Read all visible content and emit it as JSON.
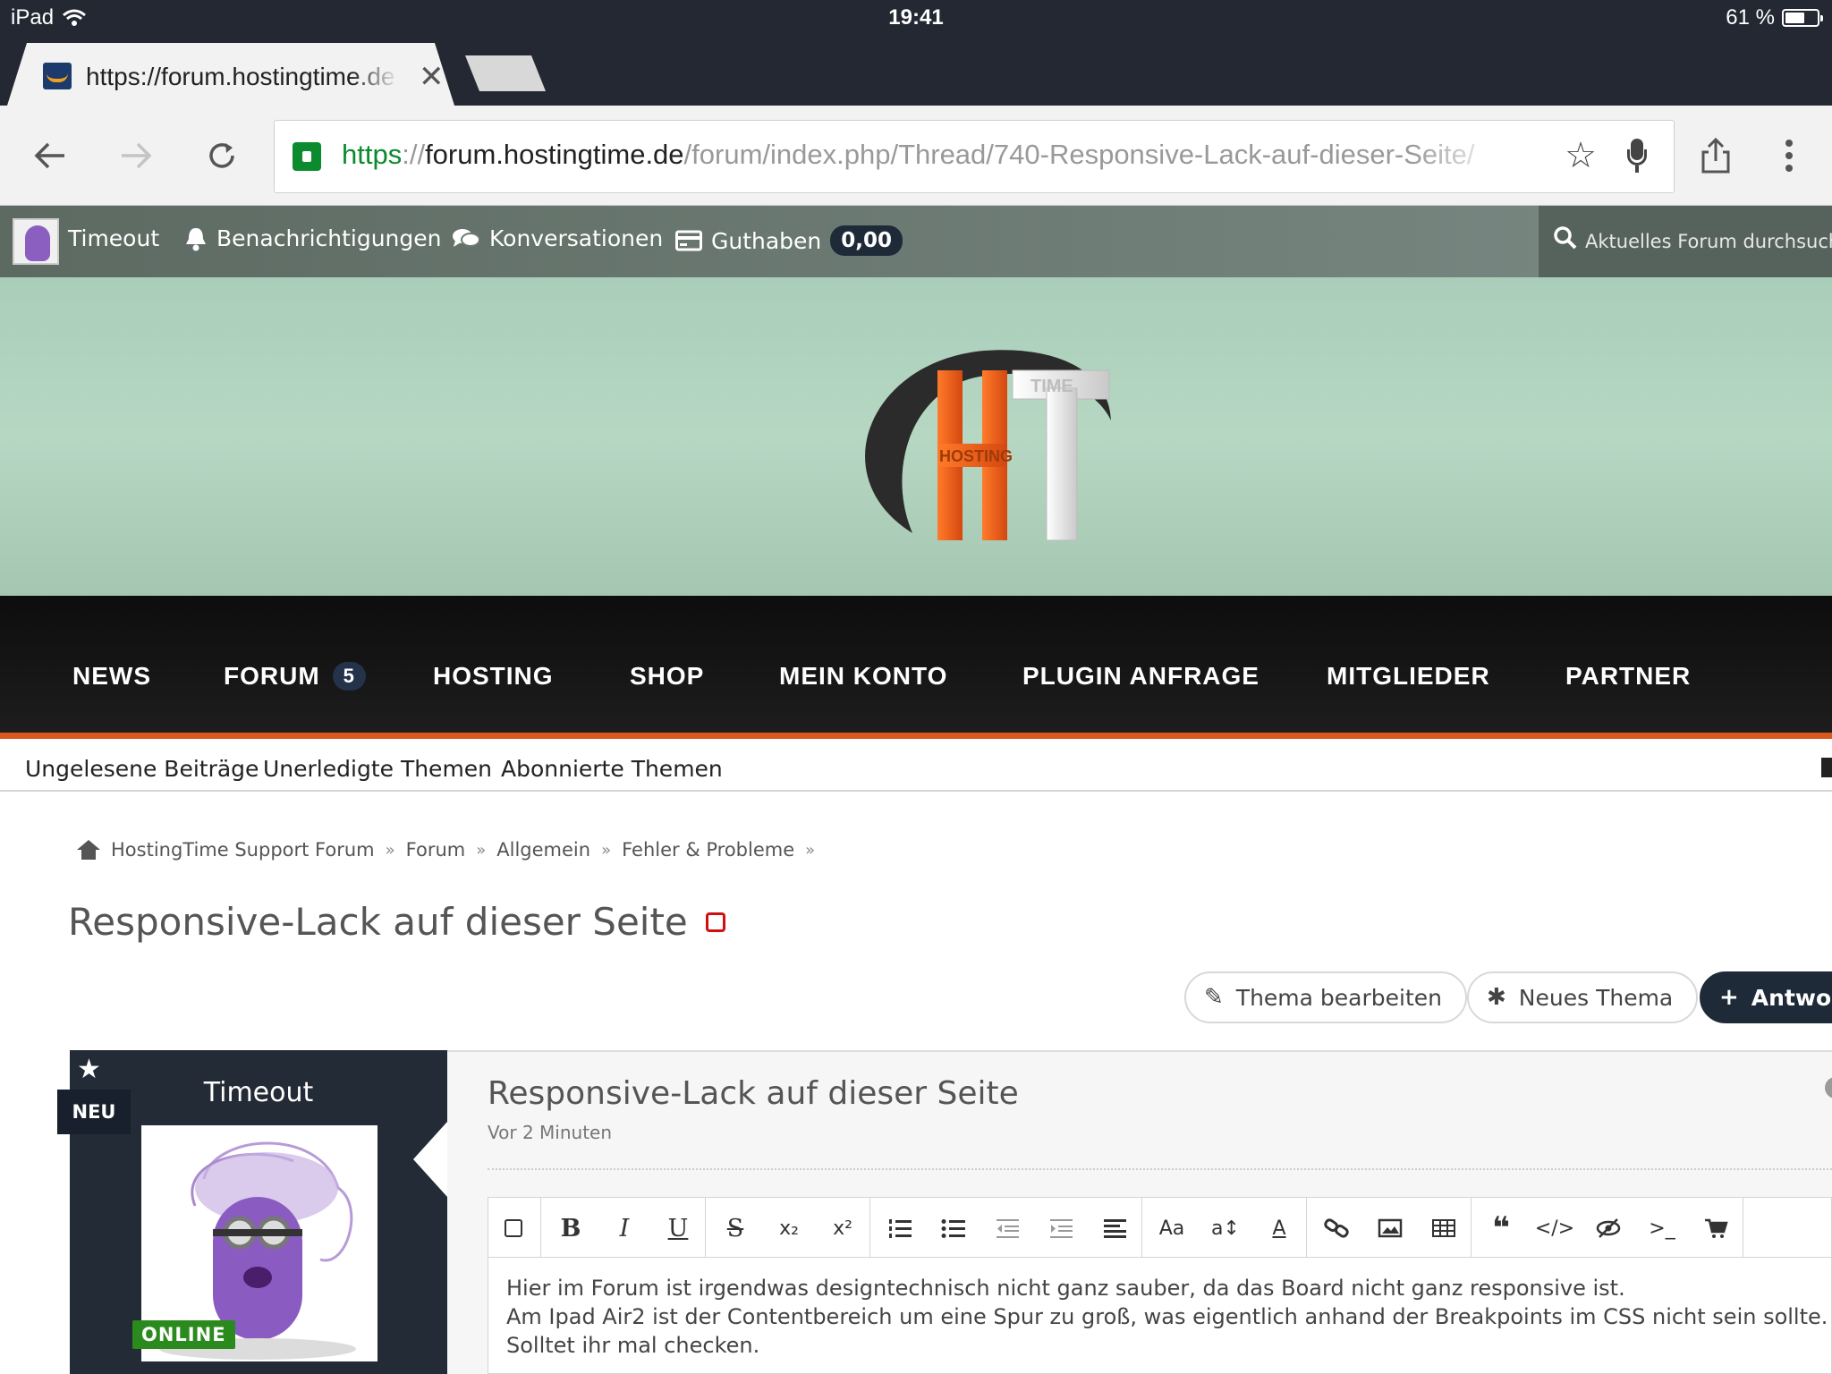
{
  "status_bar": {
    "device": "iPad",
    "time": "19:41",
    "battery": "61 %",
    "battery_level": 0.61
  },
  "browser": {
    "tab_title": "https://forum.hostingtime.de",
    "tab_close": "✕",
    "url_scheme": "https",
    "url_sep": "://",
    "url_host": "forum.hostingtime.de",
    "url_path": "/forum/index.php/Thread/740-Responsive-Lack-auf-dieser-Seite/",
    "icons": [
      "back-arrow-icon",
      "forward-arrow-icon",
      "reload-icon",
      "lock-icon",
      "star-icon",
      "microphone-icon",
      "share-icon",
      "more-menu-icon"
    ]
  },
  "userbar": {
    "username": "Timeout",
    "notifications": "Benachrichtigungen",
    "conversations": "Konversationen",
    "balance_label": "Guthaben",
    "balance_value": "0,00",
    "search_placeholder": "Aktuelles Forum durchsuchen"
  },
  "banner": {
    "logo_text_small": "HOSTING",
    "logo_text_time": "TIME"
  },
  "main_nav": {
    "items": [
      {
        "label": "NEWS"
      },
      {
        "label": "FORUM",
        "count": "5"
      },
      {
        "label": "HOSTING"
      },
      {
        "label": "SHOP"
      },
      {
        "label": "MEIN KONTO"
      },
      {
        "label": "PLUGIN ANFRAGE"
      },
      {
        "label": "MITGLIEDER"
      },
      {
        "label": "PARTNER"
      }
    ],
    "accent_color": "#d9581d"
  },
  "sub_nav": {
    "items": [
      "Ungelesene Beiträge",
      "Unerledigte Themen",
      "Abonnierte Themen"
    ]
  },
  "breadcrumb": {
    "items": [
      "HostingTime Support Forum",
      "Forum",
      "Allgemein",
      "Fehler & Probleme"
    ],
    "separator": "»"
  },
  "thread": {
    "title": "Responsive-Lack auf dieser Seite",
    "buttons": {
      "edit": "Thema bearbeiten",
      "new": "Neues Thema",
      "reply": "Antworten"
    }
  },
  "post": {
    "author": "Timeout",
    "new_tag": "NEU",
    "online": "ONLINE",
    "title": "Responsive-Lack auf dieser Seite",
    "time": "Vor 2 Minuten",
    "body_lines": [
      "Hier im Forum ist irgendwas designtechnisch nicht ganz sauber, da das Board nicht ganz responsive ist.",
      "Am Ipad Air2 ist der Contentbereich um eine Spur zu groß, was eigentlich anhand der Breakpoints im CSS nicht sein sollte.",
      "Solltet ihr mal checken."
    ]
  },
  "editor_toolbar": {
    "bold": "B",
    "italic": "I",
    "underline": "U",
    "strike": "S",
    "subscript": "x₂",
    "superscript": "x²",
    "font_size": "Aa",
    "text_size": "a↕",
    "font_color": "A"
  }
}
